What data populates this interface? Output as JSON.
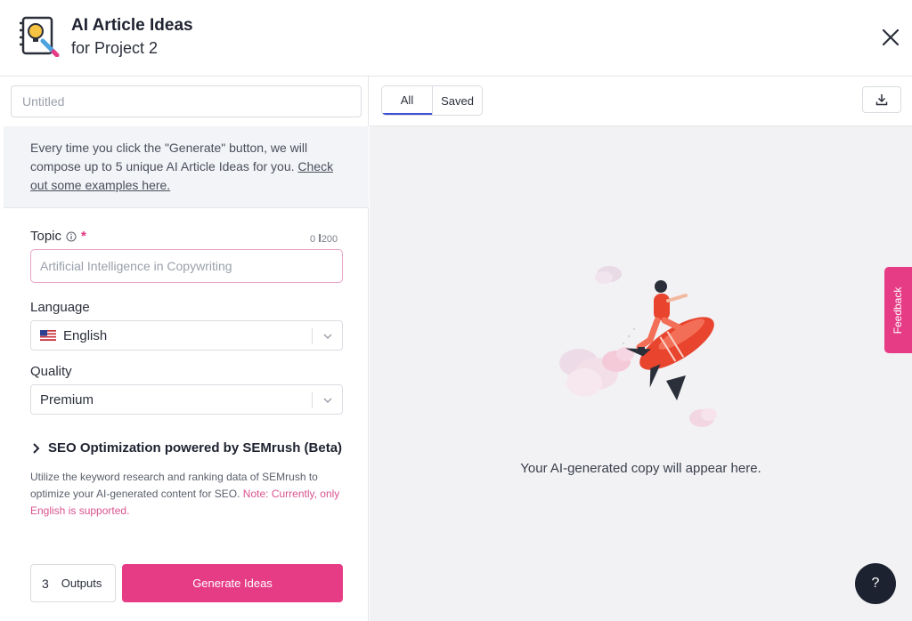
{
  "header": {
    "title": "AI Article Ideas",
    "subtitle": "for Project 2",
    "logo_icon": "notebook-lightbulb-icon",
    "close_icon": "close-icon"
  },
  "left_panel": {
    "doc_title": {
      "value": "",
      "placeholder": "Untitled"
    },
    "info": {
      "text": "Every time you click the \"Generate\" button, we will compose up to 5 unique AI Article Ideas for you. ",
      "link": "Check out some examples here."
    },
    "topic": {
      "label": "Topic",
      "required_mark": "*",
      "char_count": "0",
      "char_max": "200",
      "value": "",
      "placeholder": "Artificial Intelligence in Copywriting"
    },
    "language": {
      "label": "Language",
      "value": "English",
      "flag_icon": "us-flag-icon"
    },
    "quality": {
      "label": "Quality",
      "value": "Premium"
    },
    "seo": {
      "title": "SEO Optimization powered by SEMrush (Beta)",
      "description": "Utilize the keyword research and ranking data of SEMrush to optimize your AI-generated content for SEO. ",
      "note": "Note: Currently, only English is supported."
    },
    "outputs": {
      "count": "3",
      "label": "Outputs"
    },
    "generate_label": "Generate Ideas"
  },
  "right_panel": {
    "tabs": [
      {
        "label": "All",
        "active": true
      },
      {
        "label": "Saved",
        "active": false
      }
    ],
    "download_icon": "download-icon",
    "empty_message": "Your AI-generated copy will appear here.",
    "feedback_label": "Feedback",
    "help_label": "?"
  },
  "colors": {
    "accent": "#e63c86",
    "tab_active_underline": "#3c4fd6",
    "help_button": "#1c2230",
    "panel_background": "#f2f2f4"
  }
}
